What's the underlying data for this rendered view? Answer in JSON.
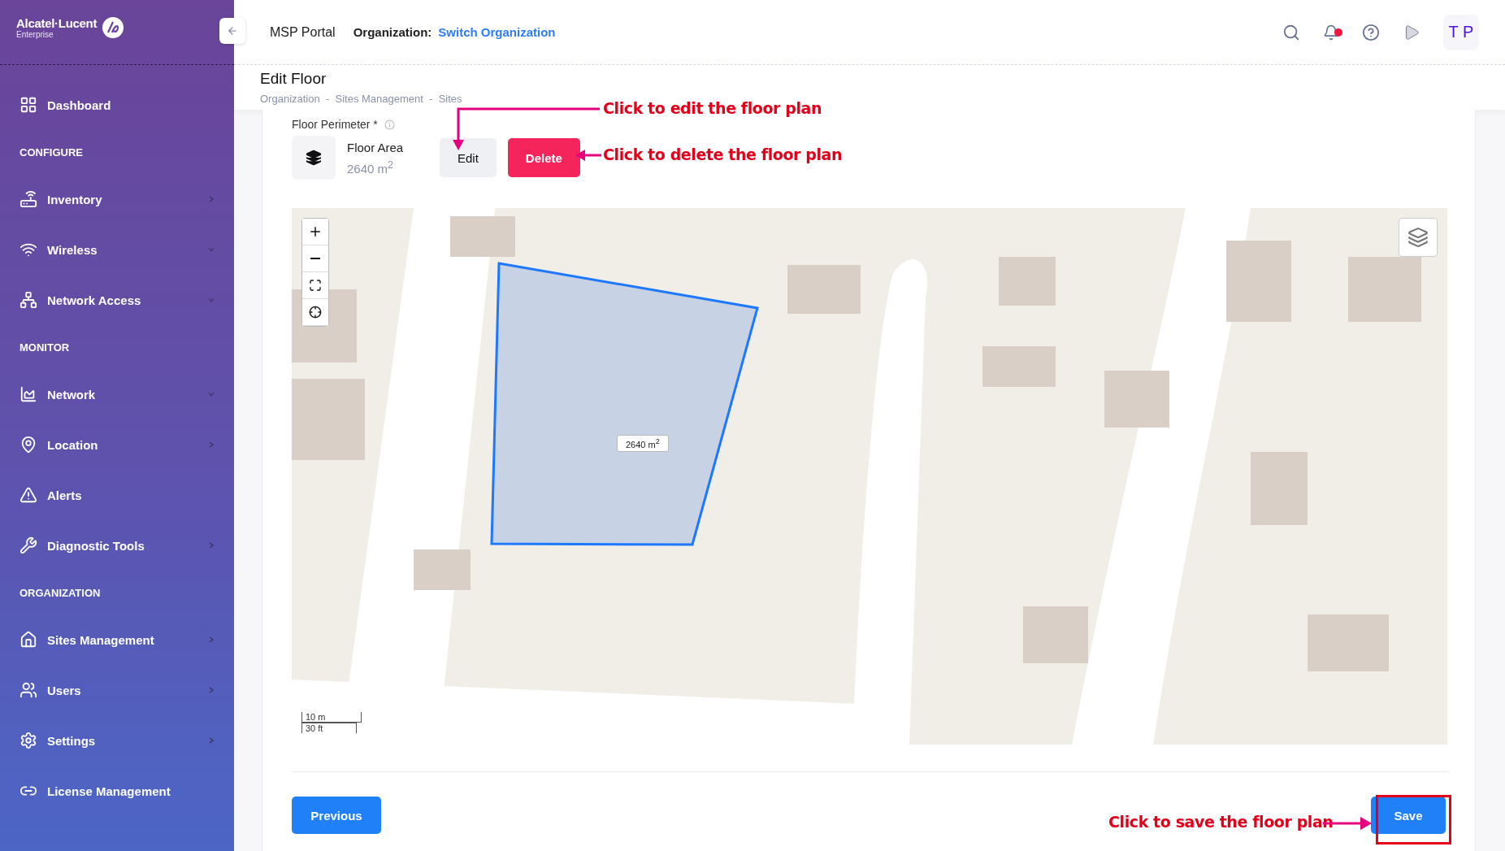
{
  "sidebar": {
    "brand": "Alcatel·Lucent",
    "brand_sub": "Enterprise",
    "items": [
      {
        "kind": "item",
        "label": "Dashboard",
        "expandable": false
      },
      {
        "kind": "heading",
        "label": "CONFIGURE"
      },
      {
        "kind": "item",
        "label": "Inventory",
        "expandable": true,
        "expanded": false
      },
      {
        "kind": "item",
        "label": "Wireless",
        "expandable": true,
        "expanded": true
      },
      {
        "kind": "item",
        "label": "Network Access",
        "expandable": true,
        "expanded": true
      },
      {
        "kind": "heading",
        "label": "MONITOR"
      },
      {
        "kind": "item",
        "label": "Network",
        "expandable": true,
        "expanded": true
      },
      {
        "kind": "item",
        "label": "Location",
        "expandable": true,
        "expanded": false
      },
      {
        "kind": "item",
        "label": "Alerts",
        "expandable": false
      },
      {
        "kind": "item",
        "label": "Diagnostic Tools",
        "expandable": true,
        "expanded": false
      },
      {
        "kind": "heading",
        "label": "ORGANIZATION"
      },
      {
        "kind": "item",
        "label": "Sites Management",
        "expandable": true,
        "expanded": false
      },
      {
        "kind": "item",
        "label": "Users",
        "expandable": true,
        "expanded": false
      },
      {
        "kind": "item",
        "label": "Settings",
        "expandable": true,
        "expanded": false
      },
      {
        "kind": "item",
        "label": "License Management",
        "expandable": false
      }
    ]
  },
  "header": {
    "portal": "MSP Portal",
    "org_label": "Organization:",
    "org_link": "Switch Organization",
    "avatar": "T P",
    "notification_dot": true
  },
  "page": {
    "title": "Edit Floor",
    "breadcrumb": "Organization  -  Sites Management  -  Sites"
  },
  "floor": {
    "label": "Floor Perimeter *",
    "area_title": "Floor Area",
    "area_value": "2640 m$^{2}$",
    "buttons": [
      "Edit",
      "Delete"
    ]
  },
  "map": {
    "area_label": "2640 m$^{2}$",
    "scale": [
      "10 m",
      "30 ft"
    ]
  },
  "footer": {
    "buttons": [
      "Previous",
      "Save"
    ]
  },
  "annotations": [
    "Click to edit the floor plan",
    "Click to delete the floor plan",
    "Click to save the floor plan"
  ]
}
